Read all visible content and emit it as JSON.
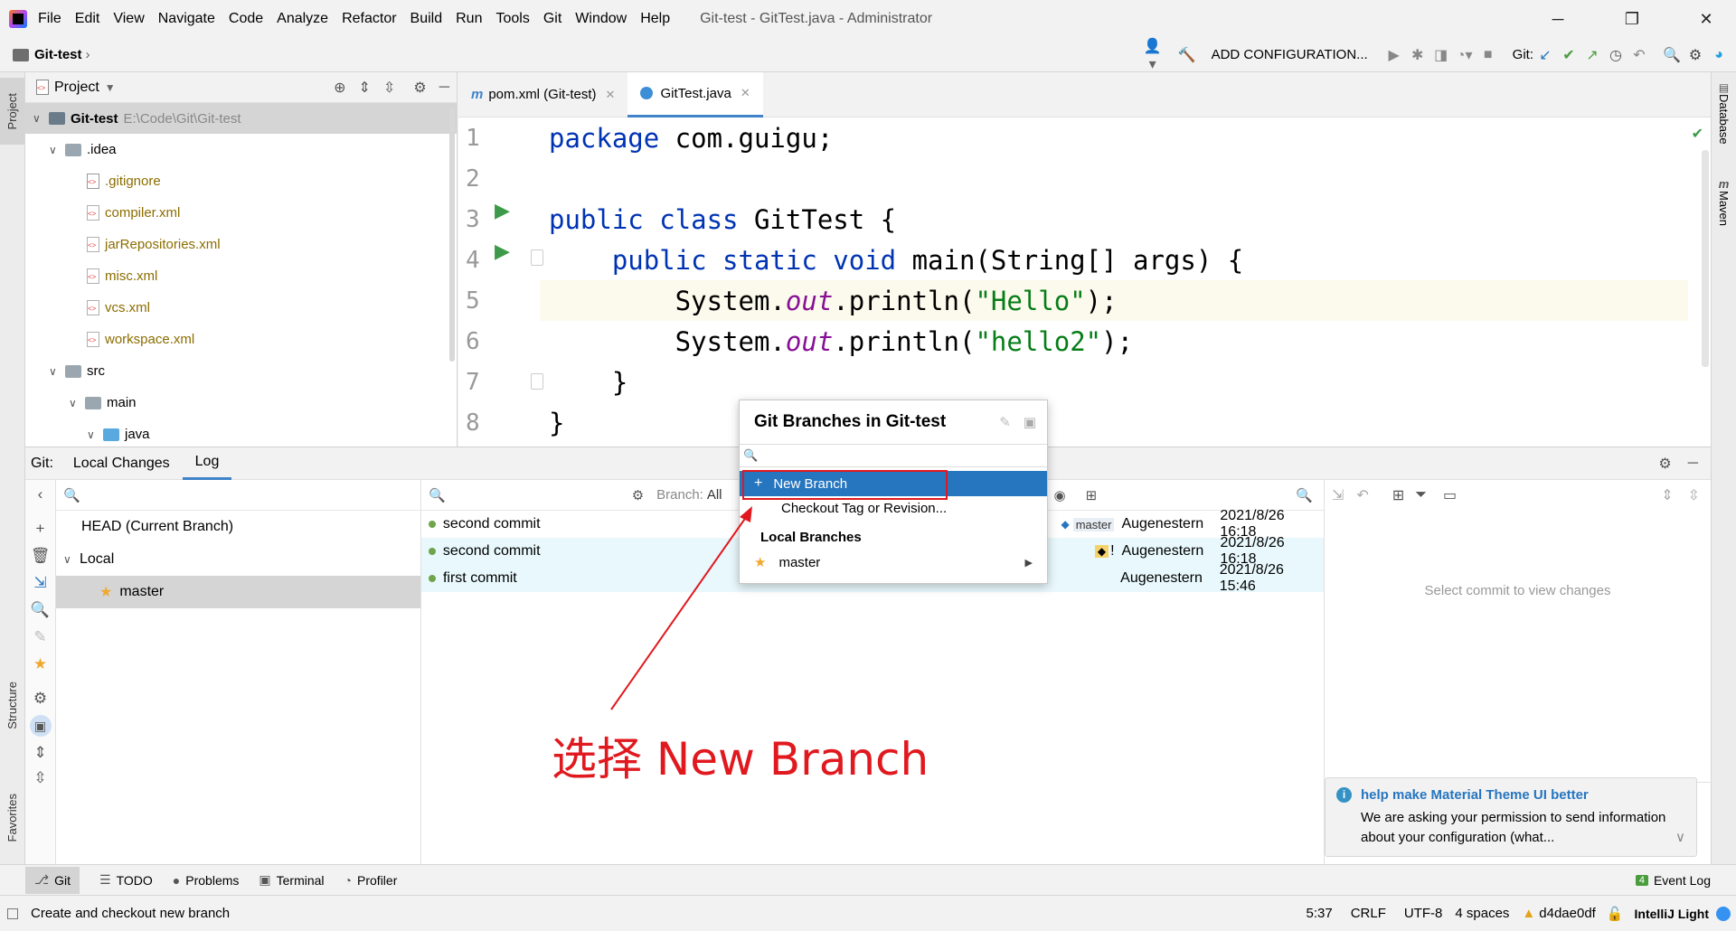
{
  "titlebar": {
    "menus": [
      "File",
      "Edit",
      "View",
      "Navigate",
      "Code",
      "Analyze",
      "Refactor",
      "Build",
      "Run",
      "Tools",
      "Git",
      "Window",
      "Help"
    ],
    "window_title": "Git-test - GitTest.java - Administrator",
    "min": "─",
    "max": "❐",
    "close": "✕"
  },
  "navbar": {
    "project_name": "Git-test",
    "add_configuration": "ADD CONFIGURATION...",
    "git_label": "Git:"
  },
  "left_strip": {
    "project": "Project",
    "structure": "Structure",
    "favorites": "Favorites"
  },
  "right_strip": {
    "database": "Database",
    "maven": "Maven"
  },
  "project_panel": {
    "title": "Project",
    "root_name": "Git-test",
    "root_path": "E:\\Code\\Git\\Git-test",
    "idea_folder": ".idea",
    "files": [
      ".gitignore",
      "compiler.xml",
      "jarRepositories.xml",
      "misc.xml",
      "vcs.xml",
      "workspace.xml"
    ],
    "src": "src",
    "main": "main",
    "java": "java"
  },
  "editor": {
    "tabs": [
      {
        "label": "pom.xml (Git-test)"
      },
      {
        "label": "GitTest.java"
      }
    ],
    "line_numbers": [
      "1",
      "2",
      "3",
      "4",
      "5",
      "6",
      "7",
      "8"
    ],
    "code": {
      "l1_kw": "package",
      "l1_rest": " com.guigu;",
      "l3_kw": "public class",
      "l3_rest": " GitTest {",
      "l4_kw": "    public static void",
      "l4_rest": " main(String[] args) {",
      "l5_a": "        System.",
      "l5_out": "out",
      "l5_b": ".println(",
      "l5_str": "\"Hello\"",
      "l5_c": ");",
      "l6_a": "        System.",
      "l6_out": "out",
      "l6_b": ".println(",
      "l6_str": "\"hello2\"",
      "l6_c": ");",
      "l7": "    }",
      "l8": "}"
    }
  },
  "git_panel": {
    "label": "Git:",
    "tabs": [
      "Local Changes",
      "Log"
    ],
    "branches": {
      "head": "HEAD (Current Branch)",
      "local": "Local",
      "master": "master"
    },
    "log_filter": {
      "branch_label": "Branch:",
      "branch_value": "All"
    },
    "commits": [
      {
        "message": "second commit",
        "tag": "master",
        "author": "Augenestern",
        "date": "2021/8/26 16:18"
      },
      {
        "message": "second commit",
        "tag": "!",
        "author": "Augenestern",
        "date": "2021/8/26 16:18"
      },
      {
        "message": "first commit",
        "tag": "",
        "author": "Augenestern",
        "date": "2021/8/26 15:46"
      }
    ],
    "details_placeholder": "Select commit to view changes"
  },
  "popup": {
    "title": "Git Branches in Git-test",
    "search_placeholder": "",
    "new_branch": "New Branch",
    "checkout": "Checkout Tag or Revision...",
    "section": "Local Branches",
    "branch": "master"
  },
  "annotation": {
    "text": "选择 New Branch",
    "color": "#e0191f"
  },
  "notification": {
    "title": "help make Material Theme UI better",
    "body": "We are asking your permission to send information about your configuration (what..."
  },
  "bottom_tabs": [
    "Git",
    "TODO",
    "Problems",
    "Terminal",
    "Profiler"
  ],
  "event_log": {
    "count": "4",
    "label": "Event Log"
  },
  "status": {
    "message": "Create and checkout new branch",
    "position": "5:37",
    "line_sep": "CRLF",
    "encoding": "UTF-8",
    "indent": "4 spaces",
    "hash": "d4dae0df",
    "theme": "IntelliJ Light"
  },
  "colors": {
    "accent": "#2675bf",
    "selection": "#2675bf",
    "row_highlight": "#e8f8fc"
  }
}
